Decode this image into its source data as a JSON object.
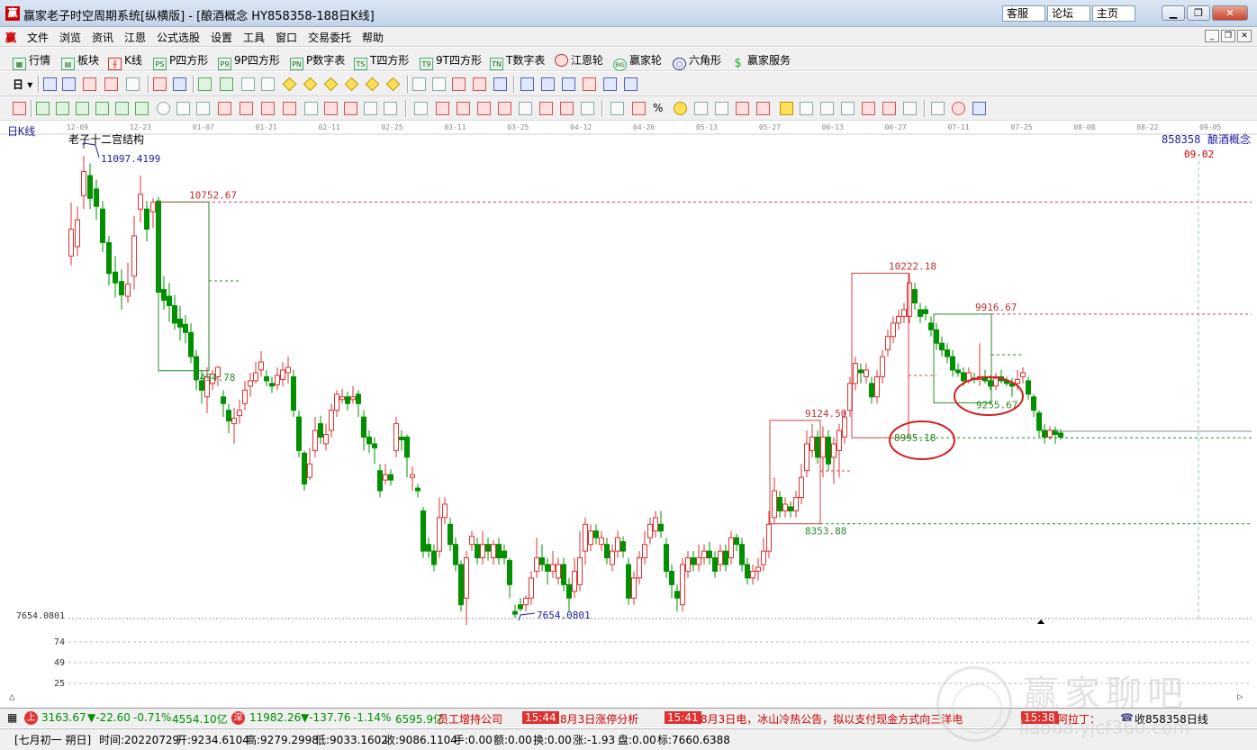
{
  "window": {
    "title": "赢家老子时空周期系统[纵横版] - [酿酒概念  HY858358-188日K线]",
    "links": [
      "客服",
      "论坛",
      "主页"
    ],
    "icon_char": "赢"
  },
  "menu": [
    "文件",
    "浏览",
    "资讯",
    "江恩",
    "公式选股",
    "设置",
    "工具",
    "窗口",
    "交易委托",
    "帮助"
  ],
  "toolbar1": [
    {
      "label": "行情",
      "icon": "table-icon"
    },
    {
      "label": "板块",
      "icon": "blocks-icon"
    },
    {
      "label": "K线",
      "icon": "candle-icon"
    },
    {
      "label": "P四方形",
      "icon": "PS"
    },
    {
      "label": "9P四方形",
      "icon": "P9"
    },
    {
      "label": "P数字表",
      "icon": "PN"
    },
    {
      "label": "T四方形",
      "icon": "TS"
    },
    {
      "label": "9T四方形",
      "icon": "T9"
    },
    {
      "label": "T数字表",
      "icon": "TN"
    },
    {
      "label": "江恩轮",
      "icon": "wheel-icon"
    },
    {
      "label": "赢家轮",
      "icon": "BIG"
    },
    {
      "label": "六角形",
      "icon": "hexagon-icon"
    },
    {
      "label": "赢家服务",
      "icon": "dollar-icon"
    }
  ],
  "toolbar2": {
    "period_label": "日"
  },
  "chart": {
    "period_label": "日K线",
    "structure_label": "老子十二宫结构",
    "stock_code": "858358",
    "stock_name": "酿酒概念",
    "cursor_date": "09-02",
    "date_ticks": [
      "12-09",
      "12-23",
      "01-07",
      "01-21",
      "02-11",
      "02-25",
      "03-11",
      "03-25",
      "04-12",
      "04-26",
      "05-13",
      "05-27",
      "06-13",
      "06-27",
      "07-11",
      "07-25",
      "08-08",
      "08-22",
      "09-05"
    ],
    "left_axis_label": "7654.0801",
    "sub_ticks": [
      "74",
      "49",
      "25"
    ],
    "price_labels": {
      "high": "11097.4199",
      "low": "7654.0801",
      "l1": "10752.67",
      "l2": "9494.78",
      "l3": "10222.18",
      "l4": "9916.67",
      "l5": "9124.50",
      "l6": "8995.18",
      "l7": "9255.67",
      "l8": "8353.88"
    },
    "colors": {
      "up": "#e03030",
      "down": "#009000",
      "blue": "#2020a0"
    }
  },
  "status1": {
    "idx1_value": "3163.67",
    "idx1_change": "▼-22.60",
    "idx1_pct": "-0.71%",
    "idx1_amount": "4554.10亿",
    "idx2_value": "11982.26",
    "idx2_change": "▼-137.76",
    "idx2_pct": "-1.14%",
    "idx2_amount": "6595.9亿",
    "news": [
      {
        "time": "",
        "text": "员工增持公司"
      },
      {
        "time": "15:44",
        "text": "8月3日涨停分析"
      },
      {
        "time": "15:41",
        "text": "8月3日电，冰山冷热公告，拟以支付现金方式向三洋电"
      },
      {
        "time": "15:38",
        "text": "阿拉丁："
      }
    ],
    "right_text": "收858358日线"
  },
  "status2": {
    "lunar": "[七月初一  朔日]",
    "time": "时间:20220729",
    "open": "开:9234.6104",
    "high": "高:9279.2998",
    "low": "低:9033.1602",
    "close": "收:9086.1104",
    "hand": "手:0.00",
    "amount": "额:0.00",
    "turnover": "换:0.00",
    "change": "涨:-1.93",
    "pan": "盘:0.00",
    "mark": "标:7660.6388"
  },
  "watermark": {
    "title": "赢家聊吧",
    "url": "liaoba.yjcf360.com"
  }
}
